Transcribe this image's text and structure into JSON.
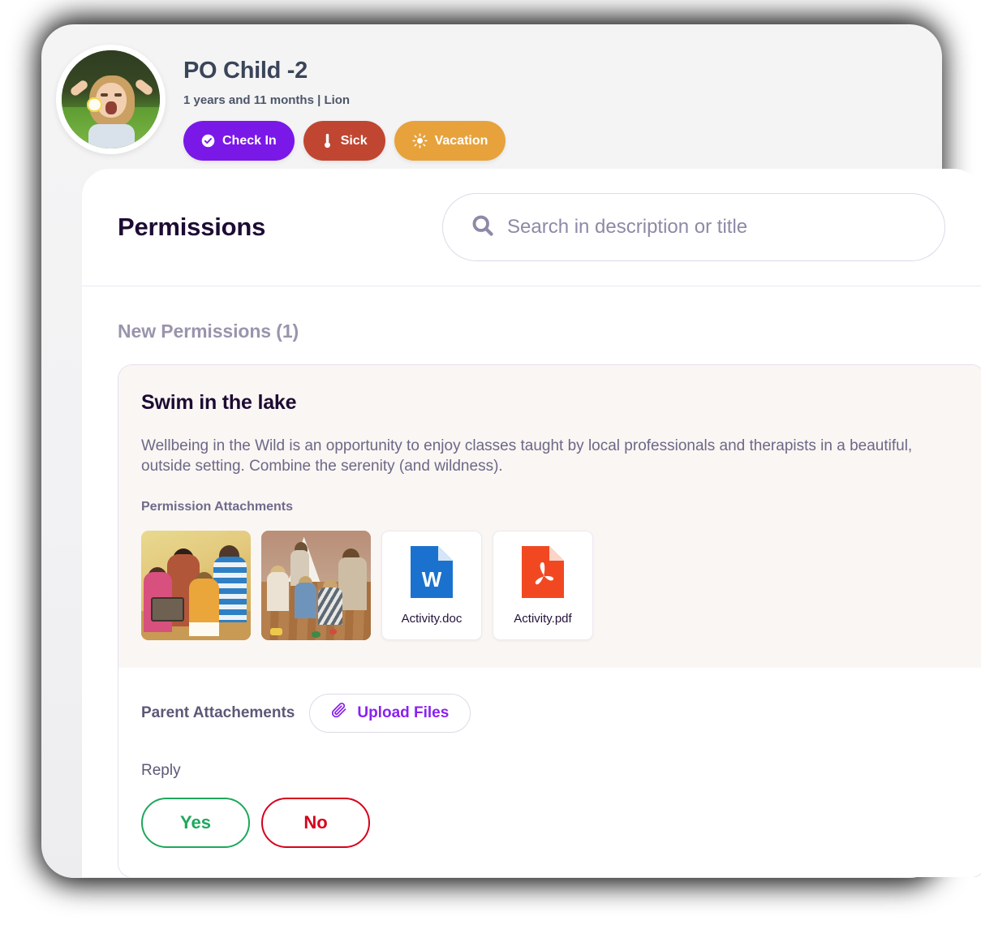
{
  "profile": {
    "name": "PO Child -2",
    "subtitle": "1 years and 11 months | Lion",
    "avatar_alt": "child-avatar-photo",
    "tags": [
      {
        "label": "Check In",
        "icon": "check-circle-icon",
        "color": "#7A18E8"
      },
      {
        "label": "Sick",
        "icon": "thermometer-icon",
        "color": "#C04632"
      },
      {
        "label": "Vacation",
        "icon": "sun-icon",
        "color": "#E7A23C"
      }
    ]
  },
  "panel": {
    "title": "Permissions",
    "search": {
      "icon": "search-icon",
      "placeholder": "Search in description or title",
      "value": ""
    },
    "section_title": "New Permissions (1)"
  },
  "permission": {
    "title": "Swim in the lake",
    "description": "Wellbeing in the Wild is an opportunity to enjoy classes taught by local professionals and therapists in a beautiful, outside setting. Combine the serenity (and wildness).",
    "attachments_label": "Permission Attachments",
    "attachments": [
      {
        "type": "image",
        "name": "classroom-photo-1",
        "label": ""
      },
      {
        "type": "image",
        "name": "classroom-photo-2",
        "label": ""
      },
      {
        "type": "doc",
        "name": "word-file-icon",
        "label": "Activity.doc"
      },
      {
        "type": "pdf",
        "name": "pdf-file-icon",
        "label": "Activity.pdf"
      }
    ],
    "parent_attachments_label": "Parent Attachements",
    "upload_label": "Upload Files",
    "upload_icon": "paperclip-icon",
    "reply_label": "Reply",
    "reply_options": [
      {
        "label": "Yes",
        "color": "#1FA75C"
      },
      {
        "label": "No",
        "color": "#D6021C"
      }
    ]
  }
}
